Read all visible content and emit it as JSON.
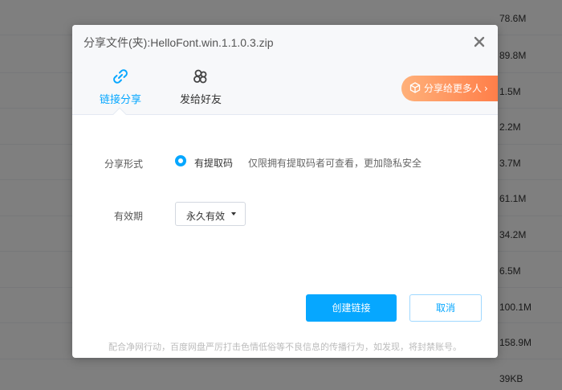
{
  "background": {
    "file_sizes": [
      "78.6M",
      "89.8M",
      "1.5M",
      "2.2M",
      "3.7M",
      "61.1M",
      "34.2M",
      "6.5M",
      "100.1M",
      "158.9M",
      "39KB"
    ]
  },
  "dialog": {
    "title": "分享文件(夹):HelloFont.win.1.1.0.3.zip",
    "tabs": [
      {
        "label": "链接分享",
        "icon": "link-icon",
        "active": true
      },
      {
        "label": "发给好友",
        "icon": "friends-icon",
        "active": false
      }
    ],
    "promo_label": "分享给更多人",
    "form": {
      "share_type_label": "分享形式",
      "share_type_option": "有提取码",
      "share_type_desc": "仅限拥有提取码者可查看，更加隐私安全",
      "expiry_label": "有效期",
      "expiry_value": "永久有效"
    },
    "create_button": "创建链接",
    "cancel_button": "取消",
    "footer_notice": "配合净网行动，百度网盘严厉打击色情低俗等不良信息的传播行为，如发现，将封禁账号。"
  },
  "colors": {
    "accent": "#06a7ff",
    "promo_start": "#ffb17a",
    "promo_end": "#ff7a45"
  }
}
